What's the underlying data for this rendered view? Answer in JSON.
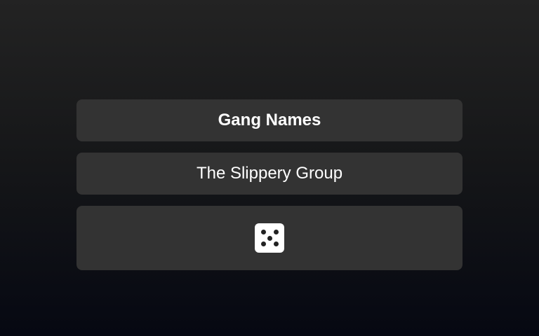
{
  "header": {
    "title": "Gang Names"
  },
  "result": {
    "name": "The Slippery Group"
  },
  "roll_button": {
    "icon": "dice-five-icon",
    "face_value": 5
  },
  "colors": {
    "panel": "#333333",
    "text": "#ffffff",
    "dice": "#ffffff",
    "pip": "#222222"
  }
}
